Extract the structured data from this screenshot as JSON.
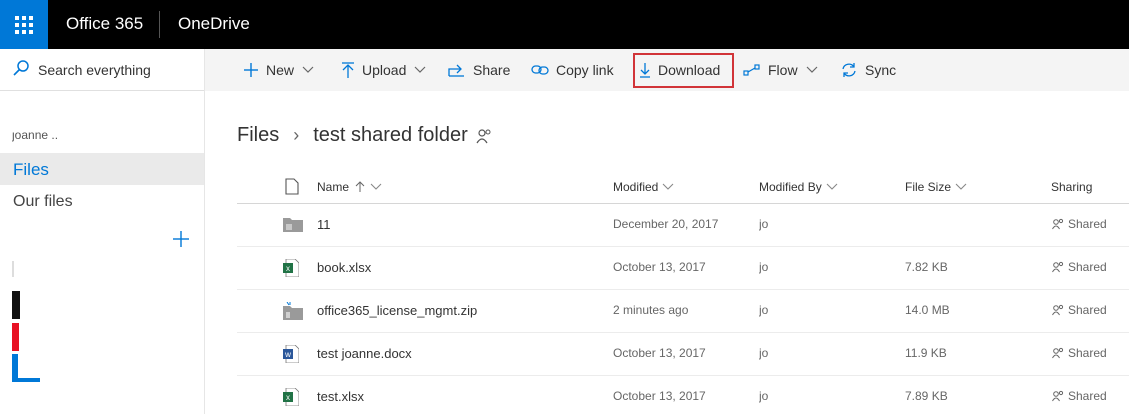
{
  "suite": {
    "brand": "Office 365",
    "app": "OneDrive"
  },
  "colors": {
    "suite_bg": "#000000",
    "waffle_bg": "#0078d7",
    "accent": "#0078d7",
    "highlight_box": "#d13438",
    "excel": "#217346",
    "word": "#2b579a"
  },
  "nav": {
    "search_label": "Search everything",
    "user": "joanne ..",
    "items": [
      {
        "label": "Files",
        "selected": true
      },
      {
        "label": "Our files",
        "selected": false
      }
    ],
    "add_icon": "plus-icon"
  },
  "toolbar": {
    "new": "New",
    "upload": "Upload",
    "share": "Share",
    "copy_link": "Copy link",
    "download": "Download",
    "flow": "Flow",
    "sync": "Sync"
  },
  "breadcrumb": {
    "root": "Files",
    "current": "test shared folder"
  },
  "columns": {
    "name": "Name",
    "modified": "Modified",
    "modified_by": "Modified By",
    "file_size": "File Size",
    "sharing": "Sharing"
  },
  "files": [
    {
      "name": "11",
      "type": "folder",
      "modified": "December 20, 2017",
      "modified_by": "jo",
      "size": "",
      "sharing": "Shared"
    },
    {
      "name": "book.xlsx",
      "type": "excel",
      "modified": "October 13, 2017",
      "modified_by": "jo",
      "size": "7.82 KB",
      "sharing": "Shared"
    },
    {
      "name": "office365_license_mgmt.zip",
      "type": "zip",
      "modified": "2 minutes ago",
      "modified_by": "jo",
      "size": "14.0 MB",
      "sharing": "Shared"
    },
    {
      "name": "test joanne.docx",
      "type": "word",
      "modified": "October 13, 2017",
      "modified_by": "jo",
      "size": "11.9 KB",
      "sharing": "Shared"
    },
    {
      "name": "test.xlsx",
      "type": "excel",
      "modified": "October 13, 2017",
      "modified_by": "jo",
      "size": "7.89 KB",
      "sharing": "Shared"
    }
  ]
}
